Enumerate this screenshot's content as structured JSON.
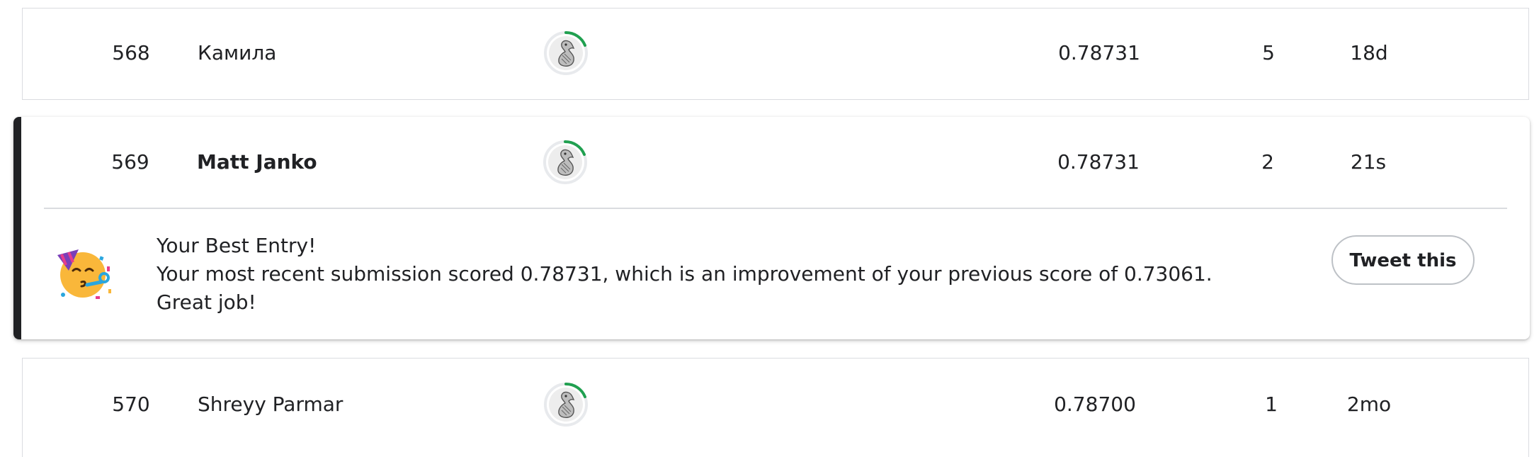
{
  "leaderboard": {
    "rows": [
      {
        "rank": "568",
        "name": "Камила",
        "score": "0.78731",
        "entries": "5",
        "last": "18d",
        "avatar_icon": "tier-medal-icon",
        "progress_fraction": 0.3
      },
      {
        "rank": "569",
        "name": "Matt Janko",
        "score": "0.78731",
        "entries": "2",
        "last": "21s",
        "avatar_icon": "tier-medal-icon",
        "progress_fraction": 0.3,
        "is_current_user": true
      },
      {
        "rank": "570",
        "name": "Shreyy Parmar",
        "score": "0.78700",
        "entries": "1",
        "last": "2mo",
        "avatar_icon": "tier-medal-icon",
        "progress_fraction": 0.3
      }
    ]
  },
  "best_entry": {
    "title": "Your Best Entry!",
    "message": "Your most recent submission scored 0.78731, which is an improvement of your previous score of 0.73061. Great job!",
    "icon": "party-face-icon",
    "tweet_label": "Tweet this"
  },
  "colors": {
    "progress_ring": "#20a050",
    "highlight_bar": "#202124",
    "border": "#dadce0"
  }
}
